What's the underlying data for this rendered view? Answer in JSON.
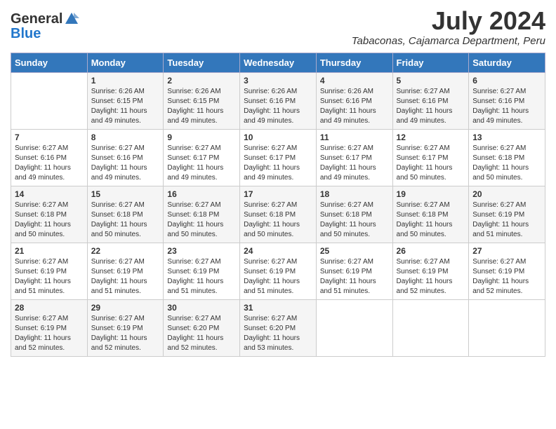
{
  "header": {
    "logo_general": "General",
    "logo_blue": "Blue",
    "month_year": "July 2024",
    "location": "Tabaconas, Cajamarca Department, Peru"
  },
  "weekdays": [
    "Sunday",
    "Monday",
    "Tuesday",
    "Wednesday",
    "Thursday",
    "Friday",
    "Saturday"
  ],
  "weeks": [
    [
      {
        "day": "",
        "info": ""
      },
      {
        "day": "1",
        "info": "Sunrise: 6:26 AM\nSunset: 6:15 PM\nDaylight: 11 hours\nand 49 minutes."
      },
      {
        "day": "2",
        "info": "Sunrise: 6:26 AM\nSunset: 6:15 PM\nDaylight: 11 hours\nand 49 minutes."
      },
      {
        "day": "3",
        "info": "Sunrise: 6:26 AM\nSunset: 6:16 PM\nDaylight: 11 hours\nand 49 minutes."
      },
      {
        "day": "4",
        "info": "Sunrise: 6:26 AM\nSunset: 6:16 PM\nDaylight: 11 hours\nand 49 minutes."
      },
      {
        "day": "5",
        "info": "Sunrise: 6:27 AM\nSunset: 6:16 PM\nDaylight: 11 hours\nand 49 minutes."
      },
      {
        "day": "6",
        "info": "Sunrise: 6:27 AM\nSunset: 6:16 PM\nDaylight: 11 hours\nand 49 minutes."
      }
    ],
    [
      {
        "day": "7",
        "info": "Sunrise: 6:27 AM\nSunset: 6:16 PM\nDaylight: 11 hours\nand 49 minutes."
      },
      {
        "day": "8",
        "info": "Sunrise: 6:27 AM\nSunset: 6:16 PM\nDaylight: 11 hours\nand 49 minutes."
      },
      {
        "day": "9",
        "info": "Sunrise: 6:27 AM\nSunset: 6:17 PM\nDaylight: 11 hours\nand 49 minutes."
      },
      {
        "day": "10",
        "info": "Sunrise: 6:27 AM\nSunset: 6:17 PM\nDaylight: 11 hours\nand 49 minutes."
      },
      {
        "day": "11",
        "info": "Sunrise: 6:27 AM\nSunset: 6:17 PM\nDaylight: 11 hours\nand 49 minutes."
      },
      {
        "day": "12",
        "info": "Sunrise: 6:27 AM\nSunset: 6:17 PM\nDaylight: 11 hours\nand 50 minutes."
      },
      {
        "day": "13",
        "info": "Sunrise: 6:27 AM\nSunset: 6:18 PM\nDaylight: 11 hours\nand 50 minutes."
      }
    ],
    [
      {
        "day": "14",
        "info": "Sunrise: 6:27 AM\nSunset: 6:18 PM\nDaylight: 11 hours\nand 50 minutes."
      },
      {
        "day": "15",
        "info": "Sunrise: 6:27 AM\nSunset: 6:18 PM\nDaylight: 11 hours\nand 50 minutes."
      },
      {
        "day": "16",
        "info": "Sunrise: 6:27 AM\nSunset: 6:18 PM\nDaylight: 11 hours\nand 50 minutes."
      },
      {
        "day": "17",
        "info": "Sunrise: 6:27 AM\nSunset: 6:18 PM\nDaylight: 11 hours\nand 50 minutes."
      },
      {
        "day": "18",
        "info": "Sunrise: 6:27 AM\nSunset: 6:18 PM\nDaylight: 11 hours\nand 50 minutes."
      },
      {
        "day": "19",
        "info": "Sunrise: 6:27 AM\nSunset: 6:18 PM\nDaylight: 11 hours\nand 50 minutes."
      },
      {
        "day": "20",
        "info": "Sunrise: 6:27 AM\nSunset: 6:19 PM\nDaylight: 11 hours\nand 51 minutes."
      }
    ],
    [
      {
        "day": "21",
        "info": "Sunrise: 6:27 AM\nSunset: 6:19 PM\nDaylight: 11 hours\nand 51 minutes."
      },
      {
        "day": "22",
        "info": "Sunrise: 6:27 AM\nSunset: 6:19 PM\nDaylight: 11 hours\nand 51 minutes."
      },
      {
        "day": "23",
        "info": "Sunrise: 6:27 AM\nSunset: 6:19 PM\nDaylight: 11 hours\nand 51 minutes."
      },
      {
        "day": "24",
        "info": "Sunrise: 6:27 AM\nSunset: 6:19 PM\nDaylight: 11 hours\nand 51 minutes."
      },
      {
        "day": "25",
        "info": "Sunrise: 6:27 AM\nSunset: 6:19 PM\nDaylight: 11 hours\nand 51 minutes."
      },
      {
        "day": "26",
        "info": "Sunrise: 6:27 AM\nSunset: 6:19 PM\nDaylight: 11 hours\nand 52 minutes."
      },
      {
        "day": "27",
        "info": "Sunrise: 6:27 AM\nSunset: 6:19 PM\nDaylight: 11 hours\nand 52 minutes."
      }
    ],
    [
      {
        "day": "28",
        "info": "Sunrise: 6:27 AM\nSunset: 6:19 PM\nDaylight: 11 hours\nand 52 minutes."
      },
      {
        "day": "29",
        "info": "Sunrise: 6:27 AM\nSunset: 6:19 PM\nDaylight: 11 hours\nand 52 minutes."
      },
      {
        "day": "30",
        "info": "Sunrise: 6:27 AM\nSunset: 6:20 PM\nDaylight: 11 hours\nand 52 minutes."
      },
      {
        "day": "31",
        "info": "Sunrise: 6:27 AM\nSunset: 6:20 PM\nDaylight: 11 hours\nand 53 minutes."
      },
      {
        "day": "",
        "info": ""
      },
      {
        "day": "",
        "info": ""
      },
      {
        "day": "",
        "info": ""
      }
    ]
  ]
}
